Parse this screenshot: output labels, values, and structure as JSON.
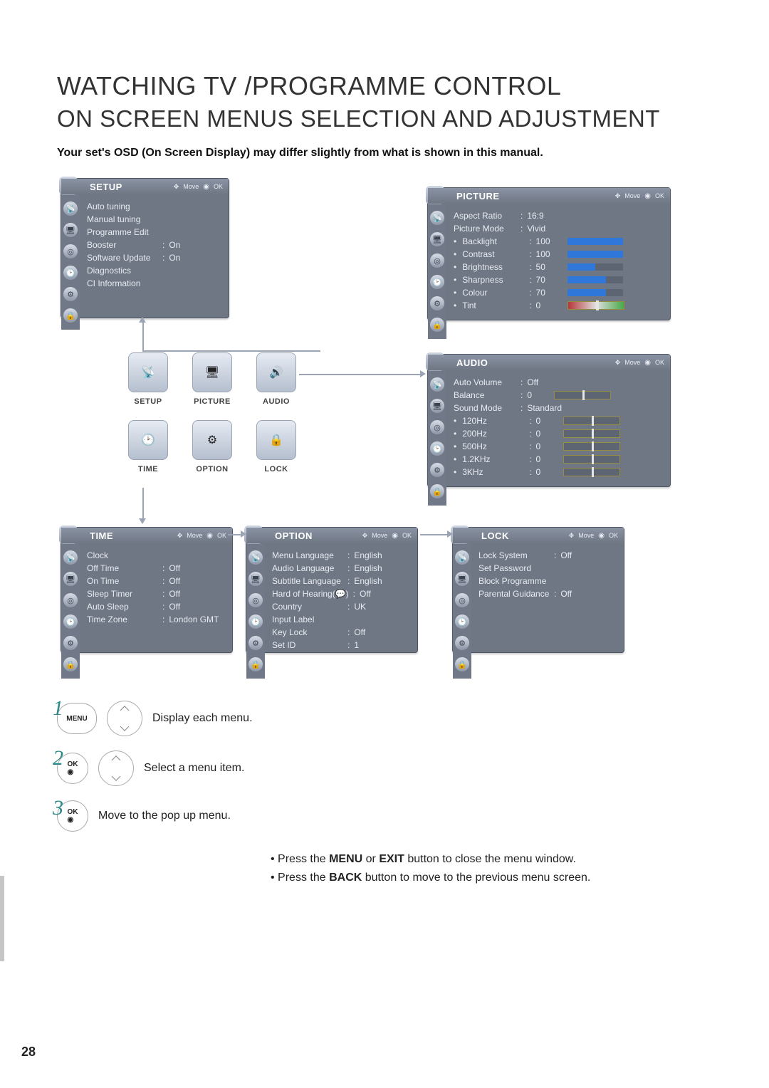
{
  "heading1": "WATCHING TV /PROGRAMME CONTROL",
  "heading2": "ON SCREEN MENUS SELECTION AND ADJUSTMENT",
  "subhead": "Your set's OSD (On Screen Display) may differ slightly from what is shown in this manual.",
  "move_ok": {
    "move": "Move",
    "ok": "OK"
  },
  "setup": {
    "title": "SETUP",
    "items": [
      {
        "label": "Auto tuning"
      },
      {
        "label": "Manual tuning"
      },
      {
        "label": "Programme Edit"
      },
      {
        "label": "Booster",
        "value": "On"
      },
      {
        "label": "Software Update",
        "value": "On"
      },
      {
        "label": "Diagnostics"
      },
      {
        "label": "CI Information"
      }
    ]
  },
  "picture": {
    "title": "PICTURE",
    "items": [
      {
        "label": "Aspect Ratio",
        "value": "16:9"
      },
      {
        "label": "Picture Mode",
        "value": "Vivid"
      },
      {
        "label": "Backlight",
        "value": "100",
        "bullet": true,
        "bar": 100
      },
      {
        "label": "Contrast",
        "value": "100",
        "bullet": true,
        "bar": 100
      },
      {
        "label": "Brightness",
        "value": "50",
        "bullet": true,
        "bar": 50
      },
      {
        "label": "Sharpness",
        "value": "70",
        "bullet": true,
        "bar": 70
      },
      {
        "label": "Colour",
        "value": "70",
        "bullet": true,
        "bar": 70
      },
      {
        "label": "Tint",
        "value": "0",
        "bullet": true,
        "tint": 50
      }
    ]
  },
  "audio": {
    "title": "AUDIO",
    "items": [
      {
        "label": "Auto Volume",
        "value": "Off"
      },
      {
        "label": "Balance",
        "value": "0",
        "slider": 50
      },
      {
        "label": "Sound Mode",
        "value": "Standard"
      },
      {
        "label": "120Hz",
        "value": "0",
        "bullet": true,
        "slider": 50
      },
      {
        "label": "200Hz",
        "value": "0",
        "bullet": true,
        "slider": 50
      },
      {
        "label": "500Hz",
        "value": "0",
        "bullet": true,
        "slider": 50
      },
      {
        "label": "1.2KHz",
        "value": "0",
        "bullet": true,
        "slider": 50
      },
      {
        "label": "3KHz",
        "value": "0",
        "bullet": true,
        "slider": 50
      }
    ]
  },
  "time": {
    "title": "TIME",
    "items": [
      {
        "label": "Clock"
      },
      {
        "label": "Off Time",
        "value": "Off"
      },
      {
        "label": "On Time",
        "value": "Off"
      },
      {
        "label": "Sleep Timer",
        "value": "Off"
      },
      {
        "label": "Auto Sleep",
        "value": "Off"
      },
      {
        "label": "Time Zone",
        "value": "London GMT"
      }
    ]
  },
  "option": {
    "title": "OPTION",
    "items": [
      {
        "label": "Menu Language",
        "value": "English"
      },
      {
        "label": "Audio Language",
        "value": "English"
      },
      {
        "label": "Subtitle Language",
        "value": "English"
      },
      {
        "label": "Hard of Hearing(💬)",
        "value": "Off"
      },
      {
        "label": "Country",
        "value": "UK"
      },
      {
        "label": "Input Label"
      },
      {
        "label": "Key Lock",
        "value": "Off"
      },
      {
        "label": "Set ID",
        "value": "1"
      }
    ]
  },
  "lock": {
    "title": "LOCK",
    "items": [
      {
        "label": "Lock System",
        "value": "Off"
      },
      {
        "label": "Set Password"
      },
      {
        "label": "Block Programme"
      },
      {
        "label": "Parental Guidance",
        "value": "Off"
      }
    ]
  },
  "cluster": {
    "setup": "SETUP",
    "picture": "PICTURE",
    "audio": "AUDIO",
    "time": "TIME",
    "option": "OPTION",
    "lock": "LOCK"
  },
  "steps": {
    "menu_btn": "MENU",
    "ok_btn": "OK",
    "s1": "Display each menu.",
    "s2": "Select a menu item.",
    "s3": "Move to the pop up menu."
  },
  "notes": {
    "n1_pre": "• Press the ",
    "n1_b": "MENU",
    "n1_mid": " or ",
    "n1_b2": "EXIT",
    "n1_post": " button to close the menu window.",
    "n2_pre": "• Press the ",
    "n2_b": "BACK",
    "n2_post": " button to move to the previous menu screen."
  },
  "page_number": "28"
}
